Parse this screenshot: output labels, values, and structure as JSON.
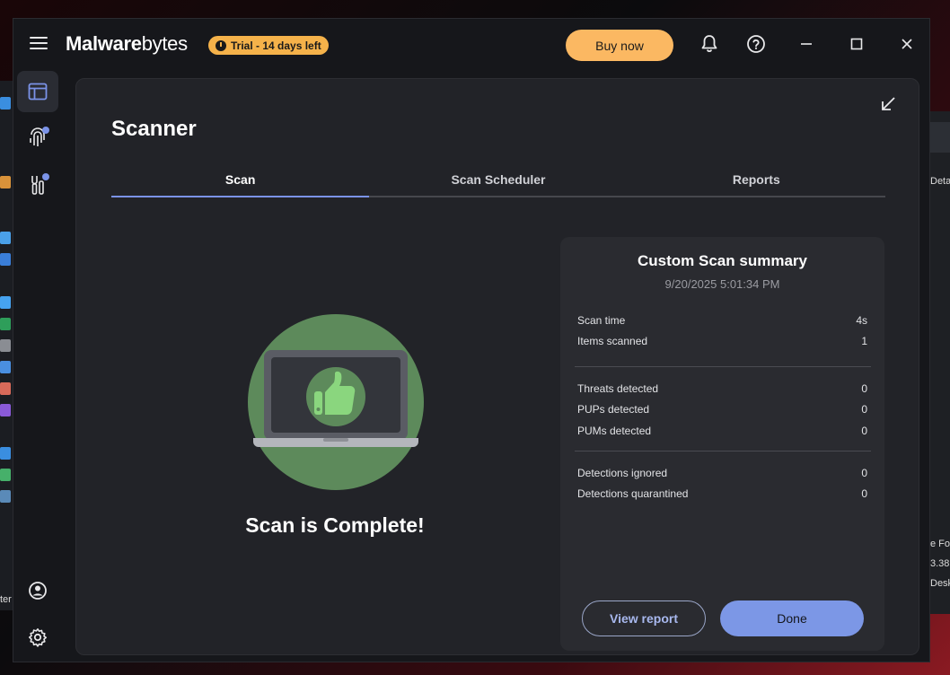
{
  "app": {
    "brand_bold": "Malware",
    "brand_thin": "bytes",
    "trial_badge": "Trial - 14 days left",
    "buy_label": "Buy now"
  },
  "page": {
    "title": "Scanner",
    "tabs": [
      {
        "label": "Scan",
        "active": true
      },
      {
        "label": "Scan Scheduler",
        "active": false
      },
      {
        "label": "Reports",
        "active": false
      }
    ],
    "status_message": "Scan is Complete!"
  },
  "summary": {
    "title": "Custom Scan summary",
    "date": "9/20/2025 5:01:34 PM",
    "rows": [
      {
        "label": "Scan time",
        "value": "4s"
      },
      {
        "label": "Items scanned",
        "value": "1"
      },
      {
        "label": "Threats detected",
        "value": "0"
      },
      {
        "label": "PUPs detected",
        "value": "0"
      },
      {
        "label": "PUMs detected",
        "value": "0"
      },
      {
        "label": "Detections ignored",
        "value": "0"
      },
      {
        "label": "Detections quarantined",
        "value": "0"
      }
    ],
    "view_report_label": "View report",
    "done_label": "Done"
  },
  "background": {
    "right_texts": [
      "Deta",
      "e Fol",
      "3.38",
      "Deskt"
    ],
    "left_text": "ter"
  },
  "colors": {
    "accent": "#7c97e6",
    "buy": "#fbb862",
    "trial": "#f5b24a",
    "illustration_bg": "#5d8a5b",
    "thumb": "#8ad67e"
  },
  "icons": [
    "menu-icon",
    "bell-icon",
    "help-icon",
    "minimize-icon",
    "maximize-icon",
    "close-icon",
    "dashboard-icon",
    "fingerprint-icon",
    "tools-icon",
    "account-icon",
    "settings-icon",
    "collapse-icon"
  ]
}
